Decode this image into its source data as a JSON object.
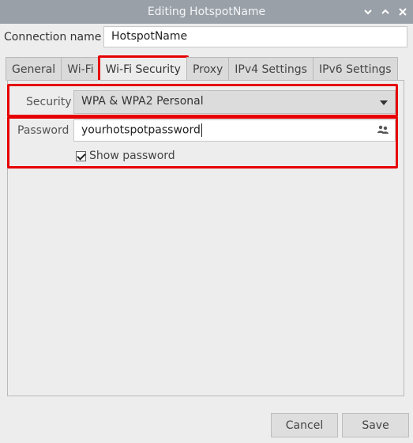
{
  "window": {
    "title": "Editing HotspotName",
    "controls": [
      "chevron-down-icon",
      "chevron-up-icon",
      "close-icon"
    ]
  },
  "connection": {
    "label": "Connection name",
    "value": "HotspotName"
  },
  "tabs": [
    {
      "label": "General"
    },
    {
      "label": "Wi-Fi"
    },
    {
      "label": "Wi-Fi Security",
      "active": true
    },
    {
      "label": "Proxy"
    },
    {
      "label": "IPv4 Settings"
    },
    {
      "label": "IPv6 Settings"
    }
  ],
  "security": {
    "label": "Security",
    "selected": "WPA & WPA2 Personal"
  },
  "password": {
    "label": "Password",
    "value": "yourhotspotpassword",
    "icon": "users-icon",
    "show_label": "Show password",
    "show_checked": true
  },
  "buttons": {
    "cancel": "Cancel",
    "save": "Save"
  },
  "colors": {
    "titlebar": "#9aa0a8",
    "highlight": "#e60000"
  }
}
